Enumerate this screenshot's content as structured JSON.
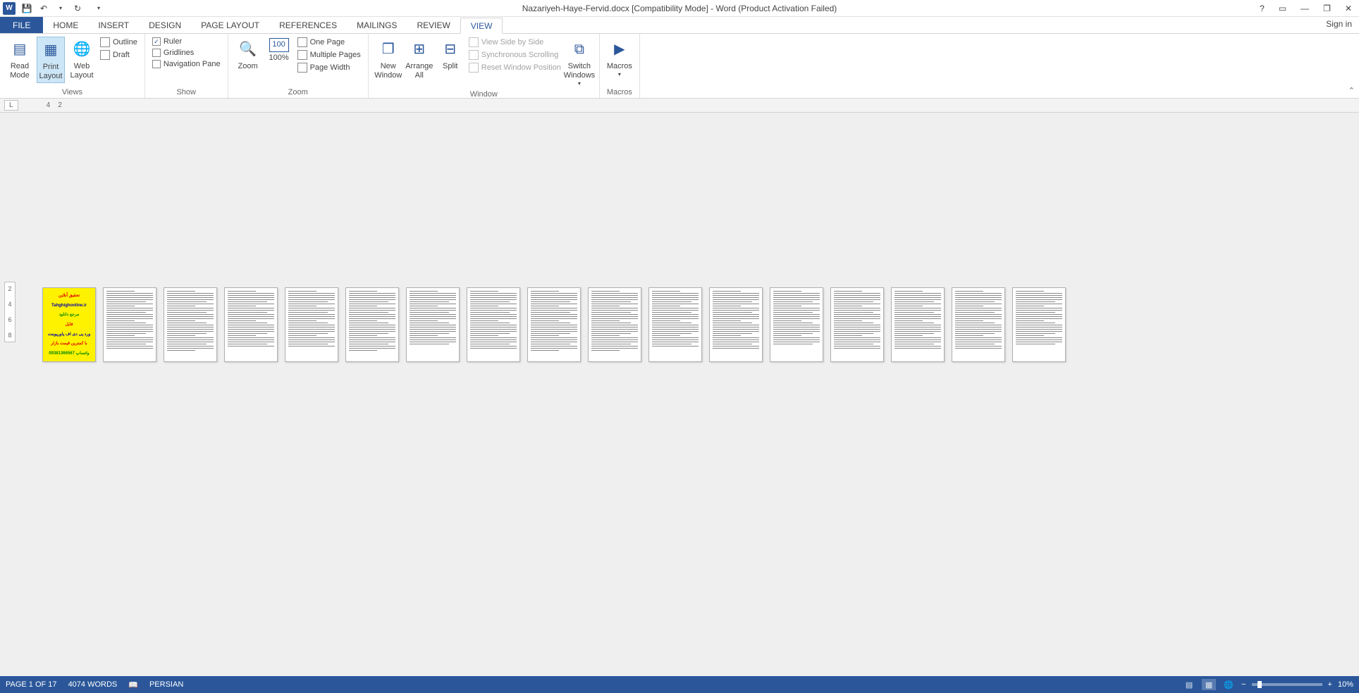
{
  "titlebar": {
    "title": "Nazariyeh-Haye-Fervid.docx [Compatibility Mode] - Word (Product Activation Failed)"
  },
  "qat": {
    "save": "💾",
    "undo": "↶",
    "redo": "↻"
  },
  "window_controls": {
    "help": "?",
    "ribbon_opts": "▭",
    "minimize": "—",
    "restore": "❐",
    "close": "✕"
  },
  "tabs": {
    "file": "FILE",
    "home": "HOME",
    "insert": "INSERT",
    "design": "DESIGN",
    "page_layout": "PAGE LAYOUT",
    "references": "REFERENCES",
    "mailings": "MAILINGS",
    "review": "REVIEW",
    "view": "VIEW",
    "signin": "Sign in"
  },
  "ribbon": {
    "views": {
      "read_mode": "Read Mode",
      "print_layout": "Print Layout",
      "web_layout": "Web Layout",
      "outline": "Outline",
      "draft": "Draft",
      "group": "Views"
    },
    "show": {
      "ruler": "Ruler",
      "gridlines": "Gridlines",
      "navigation_pane": "Navigation Pane",
      "group": "Show"
    },
    "zoom": {
      "zoom": "Zoom",
      "hundred": "100%",
      "one_page": "One Page",
      "multiple_pages": "Multiple Pages",
      "page_width": "Page Width",
      "group": "Zoom"
    },
    "window": {
      "new_window": "New Window",
      "arrange_all": "Arrange All",
      "split": "Split",
      "side_by_side": "View Side by Side",
      "sync_scroll": "Synchronous Scrolling",
      "reset_pos": "Reset Window Position",
      "switch": "Switch Windows",
      "group": "Window"
    },
    "macros": {
      "macros": "Macros",
      "group": "Macros"
    }
  },
  "ruler": {
    "h1": "4",
    "h2": "2",
    "v1": "2",
    "v2": "4",
    "v3": "6",
    "v4": "8"
  },
  "statusbar": {
    "page": "PAGE 1 OF 17",
    "words": "4074 WORDS",
    "lang": "PERSIAN",
    "zoom": "10%"
  }
}
